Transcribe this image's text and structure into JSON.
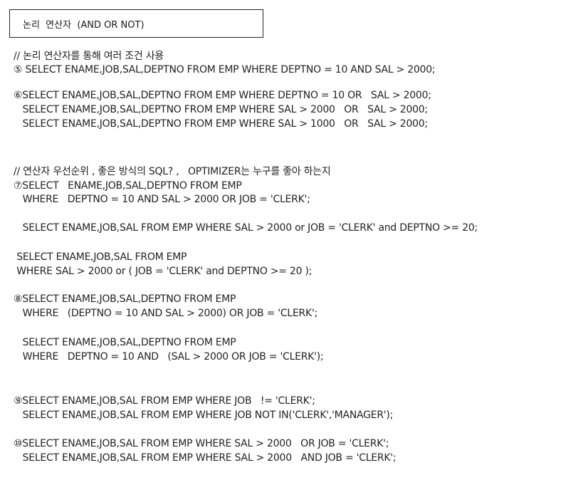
{
  "title": "논리  연산자  (AND OR NOT)",
  "lines": [
    "// 논리 연산자를 통해 여러 조건 사용",
    "⑤ SELECT ENAME,JOB,SAL,DEPTNO FROM EMP WHERE DEPTNO = 10 AND SAL > 2000;",
    "⑥SELECT ENAME,JOB,SAL,DEPTNO FROM EMP WHERE DEPTNO = 10 OR   SAL > 2000;",
    "   SELECT ENAME,JOB,SAL,DEPTNO FROM EMP WHERE SAL > 2000   OR   SAL > 2000;",
    "   SELECT ENAME,JOB,SAL,DEPTNO FROM EMP WHERE SAL > 1000   OR   SAL > 2000;",
    "// 연산자 우선순위 , 좋은 방식의 SQL? ,   OPTIMIZER는 누구를 좋아 하는지",
    "⑦SELECT   ENAME,JOB,SAL,DEPTNO FROM EMP",
    "   WHERE   DEPTNO = 10 AND SAL > 2000 OR JOB = 'CLERK';",
    "   SELECT ENAME,JOB,SAL FROM EMP WHERE SAL > 2000 or JOB = 'CLERK' and DEPTNO >= 20;",
    " SELECT ENAME,JOB,SAL FROM EMP",
    " WHERE SAL > 2000 or ( JOB = 'CLERK' and DEPTNO >= 20 );",
    "⑧SELECT ENAME,JOB,SAL,DEPTNO FROM EMP",
    "   WHERE   (DEPTNO = 10 AND SAL > 2000) OR JOB = 'CLERK';",
    "   SELECT ENAME,JOB,SAL,DEPTNO FROM EMP",
    "   WHERE   DEPTNO = 10 AND   (SAL > 2000 OR JOB = 'CLERK');",
    "⑨SELECT ENAME,JOB,SAL FROM EMP WHERE JOB   != 'CLERK';",
    "   SELECT ENAME,JOB,SAL FROM EMP WHERE JOB NOT IN('CLERK','MANAGER');",
    "⑩SELECT ENAME,JOB,SAL FROM EMP WHERE SAL > 2000   OR JOB = 'CLERK';",
    "   SELECT ENAME,JOB,SAL FROM EMP WHERE SAL > 2000   AND JOB = 'CLERK';"
  ]
}
